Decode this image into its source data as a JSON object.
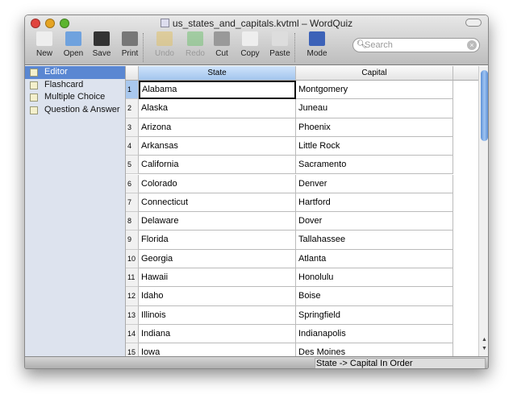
{
  "window": {
    "title": "us_states_and_capitals.kvtml – WordQuiz"
  },
  "toolbar": {
    "items": [
      {
        "label": "New",
        "icon": "new-document-icon",
        "enabled": true
      },
      {
        "label": "Open",
        "icon": "open-folder-icon",
        "enabled": true
      },
      {
        "label": "Save",
        "icon": "floppy-disk-icon",
        "enabled": true
      },
      {
        "label": "Print",
        "icon": "printer-icon",
        "enabled": true
      },
      {
        "label": "Undo",
        "icon": "undo-icon",
        "enabled": false
      },
      {
        "label": "Redo",
        "icon": "redo-icon",
        "enabled": false
      },
      {
        "label": "Cut",
        "icon": "scissors-icon",
        "enabled": true
      },
      {
        "label": "Copy",
        "icon": "copy-icon",
        "enabled": true
      },
      {
        "label": "Paste",
        "icon": "paste-icon",
        "enabled": true
      },
      {
        "label": "Mode",
        "icon": "mode-icon",
        "enabled": true
      }
    ],
    "search_placeholder": "Search"
  },
  "sidebar": {
    "items": [
      {
        "label": "Editor",
        "selected": true
      },
      {
        "label": "Flashcard"
      },
      {
        "label": "Multiple Choice"
      },
      {
        "label": "Question & Answer"
      }
    ]
  },
  "table": {
    "headers": [
      "State",
      "Capital"
    ],
    "rows": [
      [
        "1",
        "Alabama",
        "Montgomery"
      ],
      [
        "2",
        "Alaska",
        "Juneau"
      ],
      [
        "3",
        "Arizona",
        "Phoenix"
      ],
      [
        "4",
        "Arkansas",
        "Little Rock"
      ],
      [
        "5",
        "California",
        "Sacramento"
      ],
      [
        "6",
        "Colorado",
        "Denver"
      ],
      [
        "7",
        "Connecticut",
        "Hartford"
      ],
      [
        "8",
        "Delaware",
        "Dover"
      ],
      [
        "9",
        "Florida",
        "Tallahassee"
      ],
      [
        "10",
        "Georgia",
        "Atlanta"
      ],
      [
        "11",
        "Hawaii",
        "Honolulu"
      ],
      [
        "12",
        "Idaho",
        "Boise"
      ],
      [
        "13",
        "Illinois",
        "Springfield"
      ],
      [
        "14",
        "Indiana",
        "Indianapolis"
      ],
      [
        "15",
        "Iowa",
        "Des Moines"
      ]
    ]
  },
  "status": {
    "mode": "State -> Capital In Order"
  },
  "colors": {
    "selection": "#5a87d2",
    "header_selected": "#a3c6ee",
    "sidebar_bg": "#dde3ee"
  }
}
